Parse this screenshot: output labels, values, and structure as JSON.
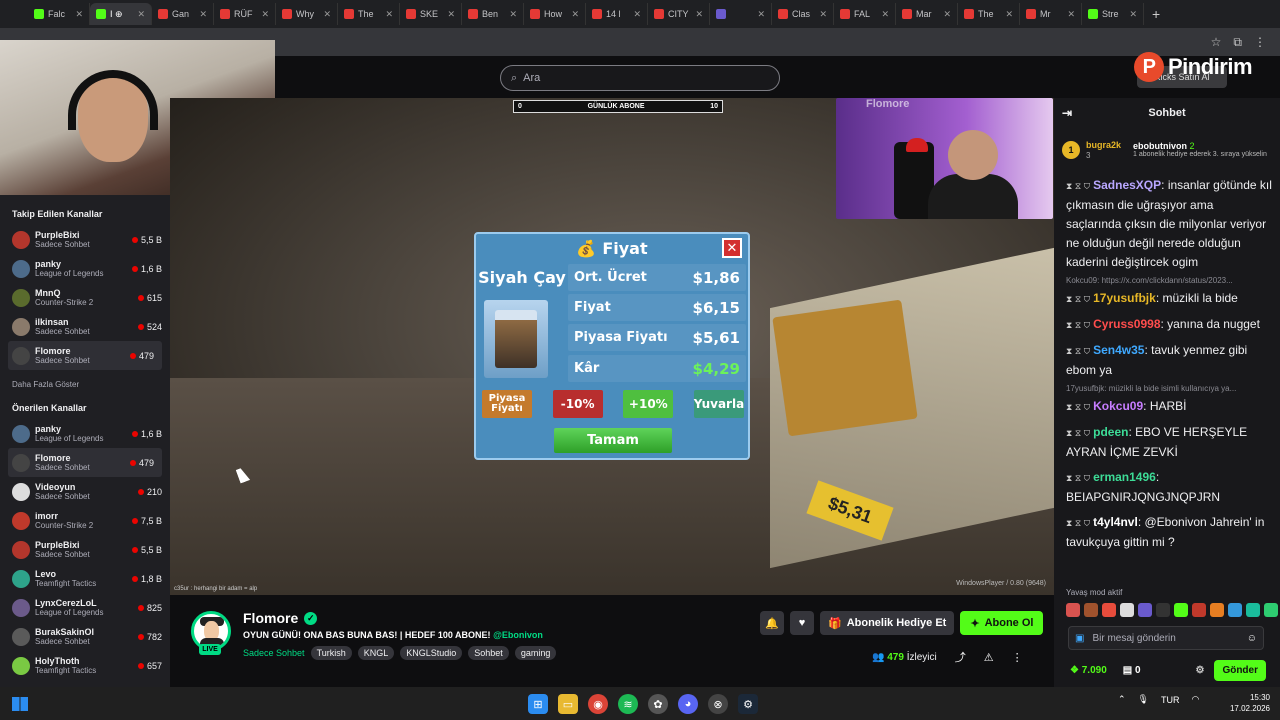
{
  "browser": {
    "tabs": [
      {
        "label": "Falc",
        "color": "#53fc18"
      },
      {
        "label": "I ⊕",
        "color": "#53fc18",
        "active": true
      },
      {
        "label": "Gan",
        "color": "#e53935"
      },
      {
        "label": "RÜF",
        "color": "#e53935"
      },
      {
        "label": "Why",
        "color": "#e53935"
      },
      {
        "label": "The",
        "color": "#e53935"
      },
      {
        "label": "SKE",
        "color": "#e53935"
      },
      {
        "label": "Ben",
        "color": "#e53935"
      },
      {
        "label": "How",
        "color": "#e53935"
      },
      {
        "label": "14 l",
        "color": "#e53935"
      },
      {
        "label": "CITY",
        "color": "#e53935"
      },
      {
        "label": "",
        "color": "#6a5acd"
      },
      {
        "label": "Clas",
        "color": "#e53935"
      },
      {
        "label": "FAL",
        "color": "#e53935"
      },
      {
        "label": "Mar",
        "color": "#e53935"
      },
      {
        "label": "The",
        "color": "#e53935"
      },
      {
        "label": "Mr",
        "color": "#e53935"
      },
      {
        "label": "Stre",
        "color": "#53fc18"
      }
    ],
    "new_tab": "+"
  },
  "header": {
    "search_placeholder": "Ara",
    "logo_text": "Pindirim",
    "logo_letter": "P",
    "bits_button": "Kicks Satın Al"
  },
  "sidebar": {
    "followed_title": "Takip Edilen Kanallar",
    "followed": [
      {
        "name": "PurpleBixi",
        "game": "Sadece Sohbet",
        "viewers": "5,5 B",
        "color": "#b3362c"
      },
      {
        "name": "panky",
        "game": "League of Legends",
        "viewers": "1,6 B",
        "color": "#4d6b8a"
      },
      {
        "name": "MnnQ",
        "game": "Counter-Strike 2",
        "viewers": "615",
        "color": "#5a6b2d"
      },
      {
        "name": "ilkinsan",
        "game": "Sadece Sohbet",
        "viewers": "524",
        "color": "#8a7a6b"
      },
      {
        "name": "Flomore",
        "game": "Sadece Sohbet",
        "viewers": "479",
        "color": "#444",
        "selected": true
      }
    ],
    "show_more": "Daha Fazla Göster",
    "recommended_title": "Önerilen Kanallar",
    "recommended": [
      {
        "name": "panky",
        "game": "League of Legends",
        "viewers": "1,6 B",
        "color": "#4d6b8a"
      },
      {
        "name": "Flomore",
        "game": "Sadece Sohbet",
        "viewers": "479",
        "color": "#444",
        "selected": true
      },
      {
        "name": "Videoyun",
        "game": "Sadece Sohbet",
        "viewers": "210",
        "color": "#ddd"
      },
      {
        "name": "imorr",
        "game": "Counter-Strike 2",
        "viewers": "7,5 B",
        "color": "#c0392b"
      },
      {
        "name": "PurpleBixi",
        "game": "Sadece Sohbet",
        "viewers": "5,5 B",
        "color": "#b3362c"
      },
      {
        "name": "Levo",
        "game": "Teamfight Tactics",
        "viewers": "1,8 B",
        "color": "#2ea38a"
      },
      {
        "name": "LynxCerezLoL",
        "game": "League of Legends",
        "viewers": "825",
        "color": "#6b5a8a"
      },
      {
        "name": "BurakSakinOl",
        "game": "Sadece Sohbet",
        "viewers": "782",
        "color": "#5a5a5a"
      },
      {
        "name": "HolyThoth",
        "game": "Teamfight Tactics",
        "viewers": "657",
        "color": "#7ac943"
      }
    ]
  },
  "stream": {
    "goal_left": "0",
    "goal_label": "GÜNLÜK ABONE",
    "goal_right": "10",
    "webcam_name": "Flomore",
    "credit": "c35ur : herhangi bir adam = alp",
    "watermark": "WindowsPlayer / 0.80 (9648)",
    "floor_sign": "$5,31"
  },
  "game_dialog": {
    "title": "Fiyat",
    "product_name": "Siyah Çay",
    "rows": [
      {
        "label": "Ort. Ücret",
        "value": "$1,86",
        "color": "#ffffff"
      },
      {
        "label": "Fiyat",
        "value": "$6,15",
        "color": "#ffffff"
      },
      {
        "label": "Piyasa Fiyatı",
        "value": "$5,61",
        "color": "#ffffff"
      },
      {
        "label": "Kâr",
        "value": "$4,29",
        "color": "#6cf25a"
      }
    ],
    "btn_market": "Piyasa Fiyatı",
    "btn_minus": "-10%",
    "btn_plus": "+10%",
    "btn_round": "Yuvarla",
    "btn_ok": "Tamam",
    "close": "✕"
  },
  "channel": {
    "name": "Flomore",
    "live_badge": "LIVE",
    "title": "OYUN GÜNÜ! ONA BAS BUNA BAS! | HEDEF 100 ABONE!",
    "title_mention": "@Ebonivon",
    "category": "Sadece Sohbet",
    "tags": [
      "Turkish",
      "KNGL",
      "KNGLStudio",
      "Sohbet",
      "gaming"
    ],
    "gift_button": "Abonelik Hediye Et",
    "sub_button": "Abone Ol",
    "viewer_count": "479",
    "viewer_label": "İzleyici"
  },
  "chat": {
    "title": "Sohbet",
    "pinned_gifter": "bugra2k",
    "pinned_gifter_count": "3",
    "pinned_rank": "1",
    "pinned_user": "ebobutnivon",
    "pinned_user_count": "2",
    "pinned_msg": "1 abonelik hediye ederek 3. sıraya yükselin",
    "messages": [
      {
        "user": "SadnesXQP",
        "color": "#b9a7ff",
        "text": "insanlar götünde kıl çıkmasın die uğraşıyor ama saçlarında çıksın die milyonlar veriyor ne olduğun değil nerede olduğun kaderini değiştircek ogim"
      },
      {
        "reply": "Kokcu09: https://x.com/clickdann/status/2023..."
      },
      {
        "user": "17yusufbjk",
        "color": "#e7b727",
        "text": "müzikli la bide"
      },
      {
        "user": "Cyruss0998",
        "color": "#ff4d4d",
        "text": "yanına da nugget"
      },
      {
        "user": "Sen4w35",
        "color": "#3fa9ff",
        "text": "tavuk yenmez gibi ebom ya"
      },
      {
        "reply": "17yusufbjk: müzikli la bide isimli kullanıcıya ya..."
      },
      {
        "user": "Kokcu09",
        "color": "#c77dff",
        "text": "HARBİ"
      },
      {
        "user": "pdeen",
        "color": "#3ddc97",
        "text": "EBO VE HERŞEYLE AYRAN İÇME ZEVKİ"
      },
      {
        "user": "erman1496",
        "color": "#3ddc97",
        "text": "BEIAPGNIRJQNGJNQPJRN"
      },
      {
        "user": "t4yl4nvl",
        "color": "#ffffff",
        "text": "@Ebonivon Jahrein' in tavukçuya gittin mi ?"
      }
    ],
    "slow_mode": "Yavaş mod aktif",
    "input_placeholder": "Bir mesaj gönderin",
    "points": "7.090",
    "boxes": "0",
    "send_button": "Gönder"
  },
  "taskbar": {
    "lang": "TUR",
    "time": "15:30",
    "date": "17.02.2026"
  }
}
